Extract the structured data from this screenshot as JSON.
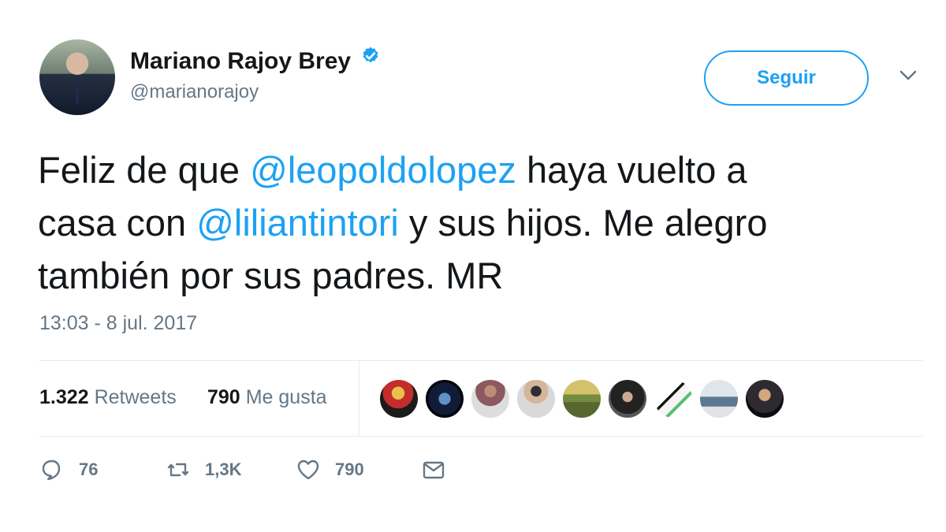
{
  "user": {
    "name": "Mariano Rajoy Brey",
    "handle": "@marianorajoy",
    "follow_label": "Seguir"
  },
  "tweet": {
    "part1": "Feliz de que ",
    "mention1": "@leopoldolopez",
    "part2": " haya vuelto a",
    "part3": "casa con ",
    "mention2": "@liliantintori",
    "part4": " y sus hijos. Me alegro",
    "part5": "también por sus padres. MR",
    "timestamp": "13:03 - 8 jul. 2017"
  },
  "stats": {
    "retweets_count": "1.322",
    "retweets_label": "Retweets",
    "likes_count": "790",
    "likes_label": "Me gusta"
  },
  "actions": {
    "reply_count": "76",
    "retweet_count": "1,3K",
    "like_count": "790"
  },
  "colors": {
    "accent": "#1da1f2",
    "text": "#14171a",
    "muted": "#657786",
    "divider": "#e6ecf0"
  },
  "icons": [
    "verified-icon",
    "chevron-down-icon",
    "reply-icon",
    "retweet-icon",
    "heart-icon",
    "mail-icon"
  ]
}
